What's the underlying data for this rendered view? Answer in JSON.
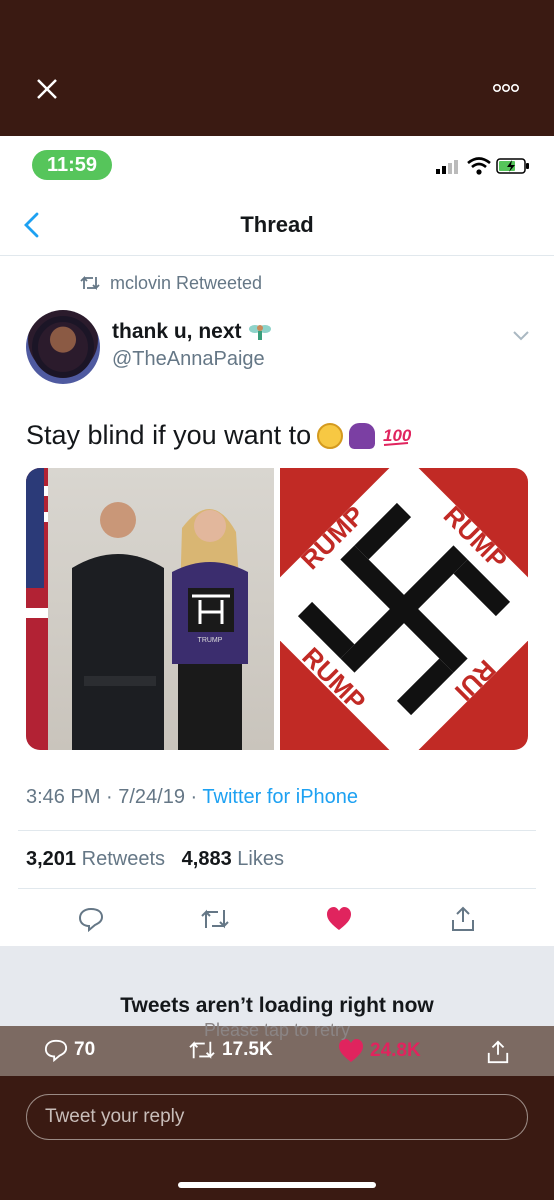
{
  "status_bar": {
    "time": "11:59"
  },
  "nav": {
    "title": "Thread"
  },
  "retweet_context": {
    "label": "mclovin Retweeted"
  },
  "tweet": {
    "display_name": "thank u, next",
    "handle": "@TheAnnaPaige",
    "text": "Stay blind if you want to",
    "timestamp": "3:46 PM · 7/24/19 ·",
    "source": "Twitter for iPhone",
    "retweets_count": "3,201",
    "retweets_label": "Retweets",
    "likes_count": "4,883",
    "likes_label": "Likes"
  },
  "graphic_text": {
    "rump_top": "RUMP",
    "rump_left": "RUMP",
    "rump_bottom": "RUMP",
    "rump_right": "RUI"
  },
  "shirt_text": "TRUMP",
  "notice": {
    "title": "Tweets aren’t loading right now",
    "subtitle": "Please tap to retry"
  },
  "bottom_stats": {
    "replies": "70",
    "retweets": "17.5K",
    "likes": "24.8K"
  },
  "reply_box": {
    "placeholder": "Tweet your reply"
  },
  "colors": {
    "accent": "#1da1f2",
    "like": "#e0245e",
    "time_pill": "#56c55b",
    "frame": "#3a1a12"
  }
}
